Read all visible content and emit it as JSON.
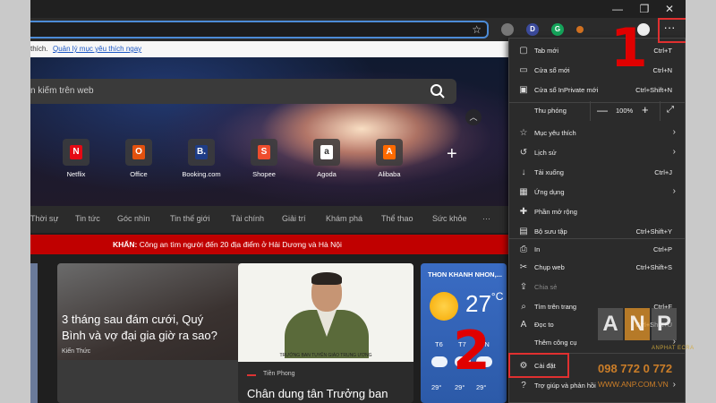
{
  "favorites_bar": {
    "text_fragment": "thích.",
    "manage_link": "Quản lý mục yêu thích ngay"
  },
  "search": {
    "placeholder": "n kiếm trên web"
  },
  "quick_links": [
    {
      "label": "Netflix",
      "letter": "N",
      "color": "#e50914"
    },
    {
      "label": "Office",
      "letter": "O",
      "color": "#e3510e"
    },
    {
      "label": "Booking.com",
      "letter": "B.",
      "color": "#1e3d87"
    },
    {
      "label": "Shopee",
      "letter": "S",
      "color": "#ee4d2d"
    },
    {
      "label": "Agoda",
      "letter": "a",
      "color": "#ffffff"
    },
    {
      "label": "Alibaba",
      "letter": "A",
      "color": "#ff6a00"
    }
  ],
  "nav": [
    "Thời sự",
    "Tin tức",
    "Góc nhìn",
    "Tin thế giới",
    "Tài chính",
    "Giải trí",
    "Khám phá",
    "Thể thao",
    "Sức khỏe",
    "···"
  ],
  "breaking": {
    "label": "KHẨN:",
    "text": "Công an tìm người đến 20 địa điểm ở Hải Dương và Hà Nội"
  },
  "cards": {
    "news_title": "3 tháng sau đám cưới, Quý Bình và vợ đại gia giờ ra sao?",
    "news_source": "Kiến Thức",
    "soldier_source": "Tiền Phong",
    "soldier_title": "Chân dung tân Trưởng ban",
    "soldier_caption": "TRƯỞNG BAN TUYÊN GIÁO TRUNG ƯƠNG"
  },
  "weather": {
    "location": "THON KHANH NHON,...",
    "temp": "27",
    "unit": "°C",
    "days": [
      "T6",
      "T7",
      "CN"
    ],
    "lows": [
      "29°",
      "29°",
      "29°"
    ]
  },
  "menu": {
    "items": [
      {
        "icon": "new-tab-icon",
        "glyph": "▢",
        "label": "Tab mới",
        "shortcut": "Ctrl+T"
      },
      {
        "icon": "new-window-icon",
        "glyph": "▭",
        "label": "Cửa sổ mới",
        "shortcut": "Ctrl+N"
      },
      {
        "icon": "inprivate-icon",
        "glyph": "▣",
        "label": "Cửa sổ InPrivate mới",
        "shortcut": "Ctrl+Shift+N"
      },
      {
        "icon": "favorites-icon",
        "glyph": "☆",
        "label": "Mục yêu thích",
        "arrow": "›"
      },
      {
        "icon": "history-icon",
        "glyph": "↺",
        "label": "Lịch sử",
        "arrow": "›"
      },
      {
        "icon": "download-icon",
        "glyph": "↓",
        "label": "Tải xuống",
        "shortcut": "Ctrl+J"
      },
      {
        "icon": "apps-icon",
        "glyph": "▦",
        "label": "Ứng dụng",
        "arrow": "›"
      },
      {
        "icon": "extensions-icon",
        "glyph": "✚",
        "label": "Phần mở rộng"
      },
      {
        "icon": "collections-icon",
        "glyph": "▤",
        "label": "Bộ sưu tập",
        "shortcut": "Ctrl+Shift+Y"
      },
      {
        "icon": "print-icon",
        "glyph": "⎙",
        "label": "In",
        "shortcut": "Ctrl+P"
      },
      {
        "icon": "web-capture-icon",
        "glyph": "✂",
        "label": "Chụp web",
        "shortcut": "Ctrl+Shift+S"
      },
      {
        "icon": "share-icon",
        "glyph": "⇪",
        "label": "Chia sẻ",
        "disabled": true
      },
      {
        "icon": "find-icon",
        "glyph": "⌕",
        "label": "Tìm trên trang",
        "shortcut": "Ctrl+F"
      },
      {
        "icon": "read-aloud-icon",
        "glyph": "A",
        "label": "Đọc to",
        "shortcut": "Ctrl+Shift+U"
      },
      {
        "icon": "more-tools-icon",
        "glyph": "",
        "label": "Thêm công cụ",
        "arrow": "›"
      },
      {
        "icon": "settings-icon",
        "glyph": "⚙",
        "label": "Cài đặt"
      },
      {
        "icon": "help-icon",
        "glyph": "?",
        "label": "Trợ giúp và phản hồi",
        "arrow": "›"
      }
    ],
    "zoom": {
      "label": "Thu phóng",
      "minus": "—",
      "value": "100%",
      "plus": "+",
      "fullscreen": "⤢"
    }
  },
  "annotations": {
    "step1": "1",
    "step2": "2"
  },
  "watermark": {
    "letters": [
      "A",
      "N",
      "P"
    ],
    "tagline": "ANPHAT ECRA",
    "phone": "098 772 0 772",
    "website": "WWW.ANP.COM.VN"
  },
  "colors": {
    "accent": "#4c8bd6",
    "breaking": "#c00000",
    "annotation": "#e00000"
  }
}
